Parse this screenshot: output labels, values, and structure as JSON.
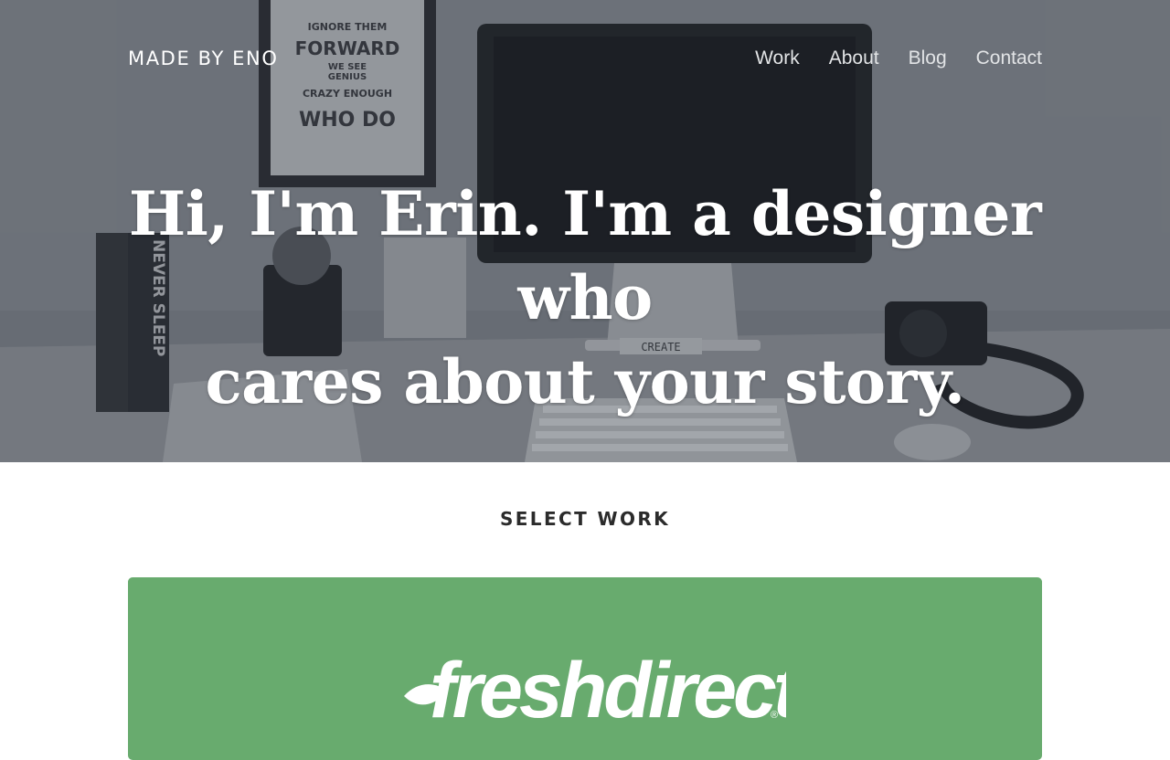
{
  "header": {
    "brand": "MADE BY ENO",
    "nav": [
      {
        "label": "Work"
      },
      {
        "label": "About"
      },
      {
        "label": "Blog"
      },
      {
        "label": "Contact"
      }
    ]
  },
  "hero": {
    "headline_line1": "Hi, I'm Erin. I'm a designer who",
    "headline_line2": "cares about your story.",
    "photo_texts": {
      "poster": [
        "IGNORE THEM",
        "FORWARD",
        "WE SEE",
        "GENIUS",
        "CRAZY ENOUGH",
        "WHO DO"
      ],
      "book_spine": "NEVER SLEEP",
      "blocks": "CREATE"
    }
  },
  "work": {
    "section_title": "SELECT WORK",
    "projects": [
      {
        "name": "freshdirect",
        "logo_text": "freshdirect",
        "registered": "®",
        "color": "#68ab6e"
      }
    ]
  },
  "colors": {
    "overlay": "#2e343c",
    "card_green": "#68ab6e",
    "section_text": "#2b2b2b",
    "nav_text": "#e2e4e6"
  }
}
